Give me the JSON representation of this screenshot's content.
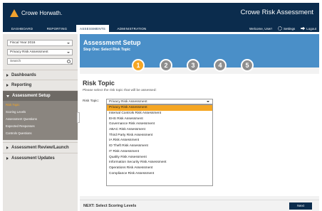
{
  "header": {
    "logo_text": "Crowe Horwath.",
    "app_title": "Crowe Risk Assessment",
    "brand_color": "#0b2c4d",
    "accent_color": "#f5a623"
  },
  "nav": {
    "tabs": [
      "DASHBOARD",
      "REPORTING",
      "ASSESSMENTS",
      "ADMINISTRATION"
    ],
    "active_tab": "ASSESSMENTS",
    "welcome": "Welcome, User!",
    "settings": "Settings",
    "logout": "Logout"
  },
  "sidebar": {
    "fiscal_year": "Fiscal Year 2016",
    "assessment": "Privacy Risk Assessment",
    "search_placeholder": "Search",
    "menu": [
      {
        "label": "Dashboards"
      },
      {
        "label": "Reporting"
      },
      {
        "label": "Assessment Setup"
      },
      {
        "label": "Assessment Review/Launch"
      },
      {
        "label": "Assessment Updates"
      }
    ],
    "submenu": [
      "Risk Topic",
      "Scoring Levels",
      "Assessment Questions",
      "Expected Responses",
      "Controls Questions"
    ],
    "active_submenu": "Risk Topic"
  },
  "banner": {
    "title": "Assessment Setup",
    "subtitle": "Step One: Select Risk Topic",
    "steps": [
      "1",
      "2",
      "3",
      "4",
      "5"
    ],
    "active_step": "1"
  },
  "content": {
    "section_title": "Risk Topic",
    "description": "Please select the risk topic that will be assessed:",
    "field_label": "Risk Topic:",
    "selected_value": "Privacy Risk Assessment",
    "options": [
      "Privacy Risk Assessment",
      "Internal Controls Risk Assessment",
      "EHS Risk Assessment",
      "Governance Risk Assessment",
      "ABAC Risk Assessment",
      "Third Party Risk Assessment",
      "IA Risk Assessment",
      "ID Theft Risk Assessment",
      "IT Risk Assessment",
      "Quality Risk Assessment",
      "Information Security Risk Assessment",
      "Operations Risk Assessment",
      "Compliance Risk Assessment"
    ]
  },
  "footer": {
    "next_text": "NEXT: Select Scoring Levels",
    "next_button": "Next"
  }
}
